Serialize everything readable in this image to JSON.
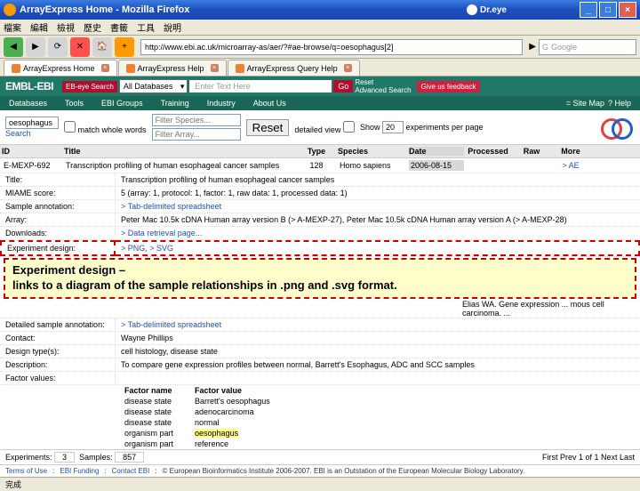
{
  "window": {
    "title": "ArrayExpress Home - Mozilla Firefox",
    "dreye": "Dr.eye",
    "url": "http://www.ebi.ac.uk/microarray-as/aer/?#ae-browse/q=oesophagus[2]",
    "search_engine": "Google"
  },
  "menu": {
    "file": "檔案",
    "edit": "編輯",
    "view": "檢視",
    "history": "歷史",
    "bookmarks": "書籤",
    "tools": "工具",
    "help": "說明"
  },
  "tabs": [
    {
      "label": "ArrayExpress Home",
      "active": true
    },
    {
      "label": "ArrayExpress Help",
      "active": false
    },
    {
      "label": "ArrayExpress Query Help",
      "active": false
    }
  ],
  "ebi": {
    "logo": "EMBL-EBI",
    "search_label": "EB-eye Search",
    "db": "All Databases",
    "input_placeholder": "Enter Text Here",
    "go": "Go",
    "reset": "Reset",
    "advanced": "Advanced Search",
    "feedback": "Give us feedback",
    "nav": [
      "Databases",
      "Tools",
      "EBI Groups",
      "Training",
      "Industry",
      "About Us"
    ],
    "nav_r": {
      "map": "= Site Map",
      "help": "? Help"
    }
  },
  "filter": {
    "kw_label": "oesophagus",
    "search_btn": "Search",
    "match": "match whole words",
    "species_ph": "Filter Species...",
    "array_ph": "Filter Array...",
    "reset": "Reset",
    "detailed": "detailed view",
    "show": "Show",
    "per_page": "experiments per page",
    "per_page_val": "20"
  },
  "table": {
    "headers": {
      "id": "ID",
      "title": "Title",
      "type": "Type",
      "species": "Species",
      "date": "Date",
      "processed": "Processed",
      "raw": "Raw",
      "more": "More"
    },
    "row": {
      "id": "E-MEXP-692",
      "title": "Transcription profiling of human esophageal cancer samples",
      "type": "128",
      "species": "Homo sapiens",
      "date": "2006-08-15",
      "more": "> AE"
    }
  },
  "detail": {
    "title_label": "Title:",
    "title_val": "Transcription profiling of human esophageal cancer samples",
    "miame_label": "MIAME score:",
    "miame_val": "5 (array: 1, protocol: 1, factor: 1, raw data: 1, processed data: 1)",
    "sample_anno_label": "Sample annotation:",
    "sample_anno_val": "> Tab-delimited spreadsheet",
    "array_label": "Array:",
    "array_val": "Peter Mac 10.5k cDNA Human array version B (> A-MEXP-27), Peter Mac 10.5k cDNA Human array version A (> A-MEXP-28)",
    "downloads_label": "Downloads:",
    "downloads_val": "> Data retrieval page...",
    "expdesign_label": "Experiment design:",
    "expdesign_val": "> PNG, > SVG",
    "callout": "Experiment design –\nlinks to a diagram of the sample relationships in .png and .svg format.",
    "row2_tail": "Elias WA. Gene expression ... mous cell carcinoma. ...",
    "detailed_sample_label": "Detailed sample annotation:",
    "detailed_sample_val": "> Tab-delimited spreadsheet",
    "contact_label": "Contact:",
    "contact_val": "Wayne Phillips",
    "designtype_label": "Design type(s):",
    "designtype_val": "cell histology, disease state",
    "description_label": "Description:",
    "description_val": "To compare gene expression profiles between normal, Barrett's Esophagus, ADC and SCC samples",
    "factor_label": "Factor values:",
    "factor_hdr_name": "Factor name",
    "factor_hdr_val": "Factor value",
    "factors": [
      {
        "name": "disease state",
        "val": "Barrett's oesophagus"
      },
      {
        "name": "disease state",
        "val": "adenocarcinoma"
      },
      {
        "name": "disease state",
        "val": "normal"
      },
      {
        "name": "organism part",
        "val": "oesophagus",
        "hl": true
      },
      {
        "name": "organism part",
        "val": "reference"
      }
    ]
  },
  "pager": {
    "experiments_label": "Experiments:",
    "experiments": "3",
    "samples_label": "Samples:",
    "samples": "857",
    "nav": "First  Prev   1   of   1   Next  Last"
  },
  "footer": {
    "terms": "Terms of Use",
    "funding": "EBI Funding",
    "contact": "Contact EBI",
    "copyright": "© European Bioinformatics Institute 2006-2007. EBI is an Outstation of the European Molecular Biology Laboratory."
  },
  "status": "完成"
}
